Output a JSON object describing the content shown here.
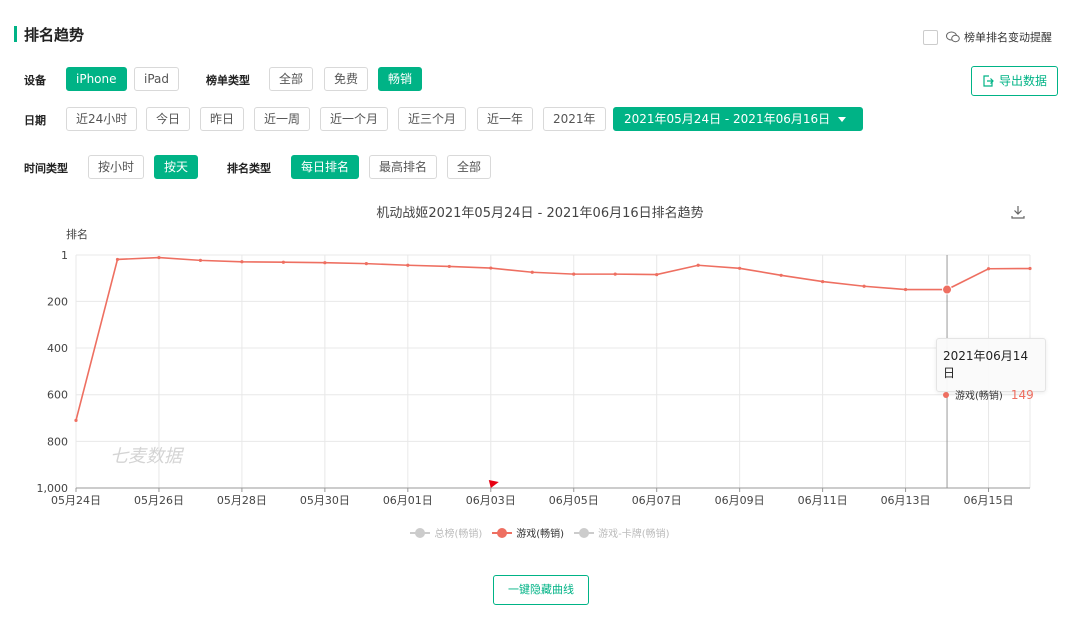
{
  "header": {
    "title": "排名趋势",
    "remind_label": "榜单排名变动提醒",
    "export_label": "导出数据"
  },
  "filters": {
    "device": {
      "label": "设备",
      "options": [
        "iPhone",
        "iPad"
      ],
      "selected": "iPhone"
    },
    "list_type": {
      "label": "榜单类型",
      "options": [
        "全部",
        "免费",
        "畅销"
      ],
      "selected": "畅销"
    },
    "date": {
      "label": "日期",
      "options": [
        "近24小时",
        "今日",
        "昨日",
        "近一周",
        "近一个月",
        "近三个月",
        "近一年",
        "2021年"
      ],
      "range": "2021年05月24日 - 2021年06月16日"
    },
    "time_type": {
      "label": "时间类型",
      "options": [
        "按小时",
        "按天"
      ],
      "selected": "按天"
    },
    "rank_type": {
      "label": "排名类型",
      "options": [
        "每日排名",
        "最高排名",
        "全部"
      ],
      "selected": "每日排名"
    }
  },
  "colors": {
    "accent": "#00b386",
    "series": "#ee6f61",
    "inactive": "#cccccc"
  },
  "icons": {
    "download": "download-icon",
    "export": "export-icon",
    "wechat": "wechat-icon",
    "flag": "flag-icon"
  },
  "watermark": "七麦数据",
  "tooltip": {
    "date": "2021年06月14日",
    "series": "游戏(畅销)",
    "value": "149"
  },
  "hide_all_label": "一键隐藏曲线",
  "chart_data": {
    "type": "line",
    "title": "机动战姬2021年05月24日 - 2021年06月16日排名趋势",
    "ylabel": "排名",
    "xlabel": "",
    "y_inverted": true,
    "ylim": [
      1,
      1000
    ],
    "yticks": [
      1,
      200,
      400,
      600,
      800,
      1000
    ],
    "ytick_labels": [
      "1",
      "200",
      "400",
      "600",
      "800",
      "1,000"
    ],
    "x": [
      "05月24日",
      "05月25日",
      "05月26日",
      "05月27日",
      "05月28日",
      "05月29日",
      "05月30日",
      "05月31日",
      "06月01日",
      "06月02日",
      "06月03日",
      "06月04日",
      "06月05日",
      "06月06日",
      "06月07日",
      "06月08日",
      "06月09日",
      "06月10日",
      "06月11日",
      "06月12日",
      "06月13日",
      "06月14日",
      "06月15日",
      "06月16日"
    ],
    "xtick_labels": [
      "05月24日",
      "05月26日",
      "05月28日",
      "05月30日",
      "06月01日",
      "06月03日",
      "06月05日",
      "06月07日",
      "06月09日",
      "06月11日",
      "06月13日",
      "06月15日"
    ],
    "series": [
      {
        "name": "总榜(畅销)",
        "visible": false,
        "values": []
      },
      {
        "name": "游戏(畅销)",
        "visible": true,
        "values": [
          710,
          20,
          12,
          24,
          30,
          32,
          34,
          38,
          45,
          50,
          57,
          75,
          83,
          83,
          85,
          45,
          58,
          88,
          115,
          135,
          149,
          149,
          60,
          59
        ]
      },
      {
        "name": "游戏-卡牌(畅销)",
        "visible": false,
        "values": []
      }
    ],
    "highlight_index": 21,
    "marker": {
      "type": "flag",
      "x": "06月03日"
    },
    "grid": true,
    "legend": "bottom-center"
  }
}
